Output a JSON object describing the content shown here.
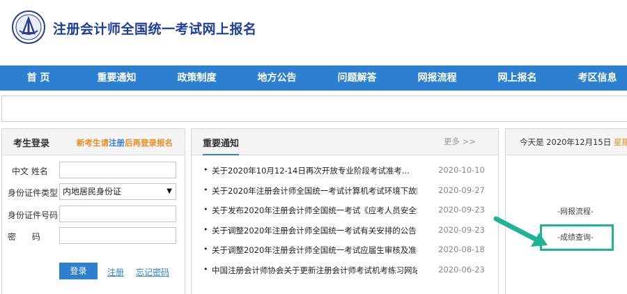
{
  "header": {
    "title": "注册会计师全国统一考试网上报名"
  },
  "nav": {
    "items": [
      "首 页",
      "重要通知",
      "政策制度",
      "地方公告",
      "问题解答",
      "网报流程",
      "网上报名",
      "考区信息"
    ]
  },
  "login": {
    "title": "考生登录",
    "hint_prefix": "新考生请",
    "hint_link": "注册",
    "hint_suffix": "后再登录报名",
    "fields": {
      "name_label": "中文 姓名",
      "id_type_label": "身份证件类型",
      "id_type_value": "内地居民身份证",
      "id_number_label": "身份证件号码",
      "password_label": "密      码"
    },
    "login_button": "登录",
    "register_link": "注册",
    "forgot_link": "忘记密码"
  },
  "news": {
    "title": "重要通知",
    "more": "更多 >>",
    "items": [
      {
        "title": "关于2020年10月12-14日再次开放专业阶段考试准考...",
        "date": "2020-10-10"
      },
      {
        "title": "关于2020年注册会计师全国统一考试计算机考试环境下故障...",
        "date": "2020-09-27"
      },
      {
        "title": "关于发布2020年注册会计师全国统一考试《应考人员安全承...",
        "date": "2020-09-23"
      },
      {
        "title": "关于调整2020年注册会计师全国统一考试有关安排的公告",
        "date": "2020-09-23"
      },
      {
        "title": "关于调整2020年注册会计师全国统一考试应届生审核及准考...",
        "date": "2020-08-18"
      },
      {
        "title": "中国注册会计师协会关于更新注册会计师考试机考练习网站的公...",
        "date": "2020-06-23"
      }
    ]
  },
  "sidebar": {
    "today_prefix": "今天是 2020年12月15日",
    "weekday": "星期二",
    "process_link": "-网报流程-",
    "score_link": "-成绩查询-"
  },
  "colors": {
    "brand_blue": "#2d7fd2",
    "title_blue": "#1d3e9a",
    "accent_orange": "#f08c24",
    "highlight_teal": "#1fb395"
  }
}
